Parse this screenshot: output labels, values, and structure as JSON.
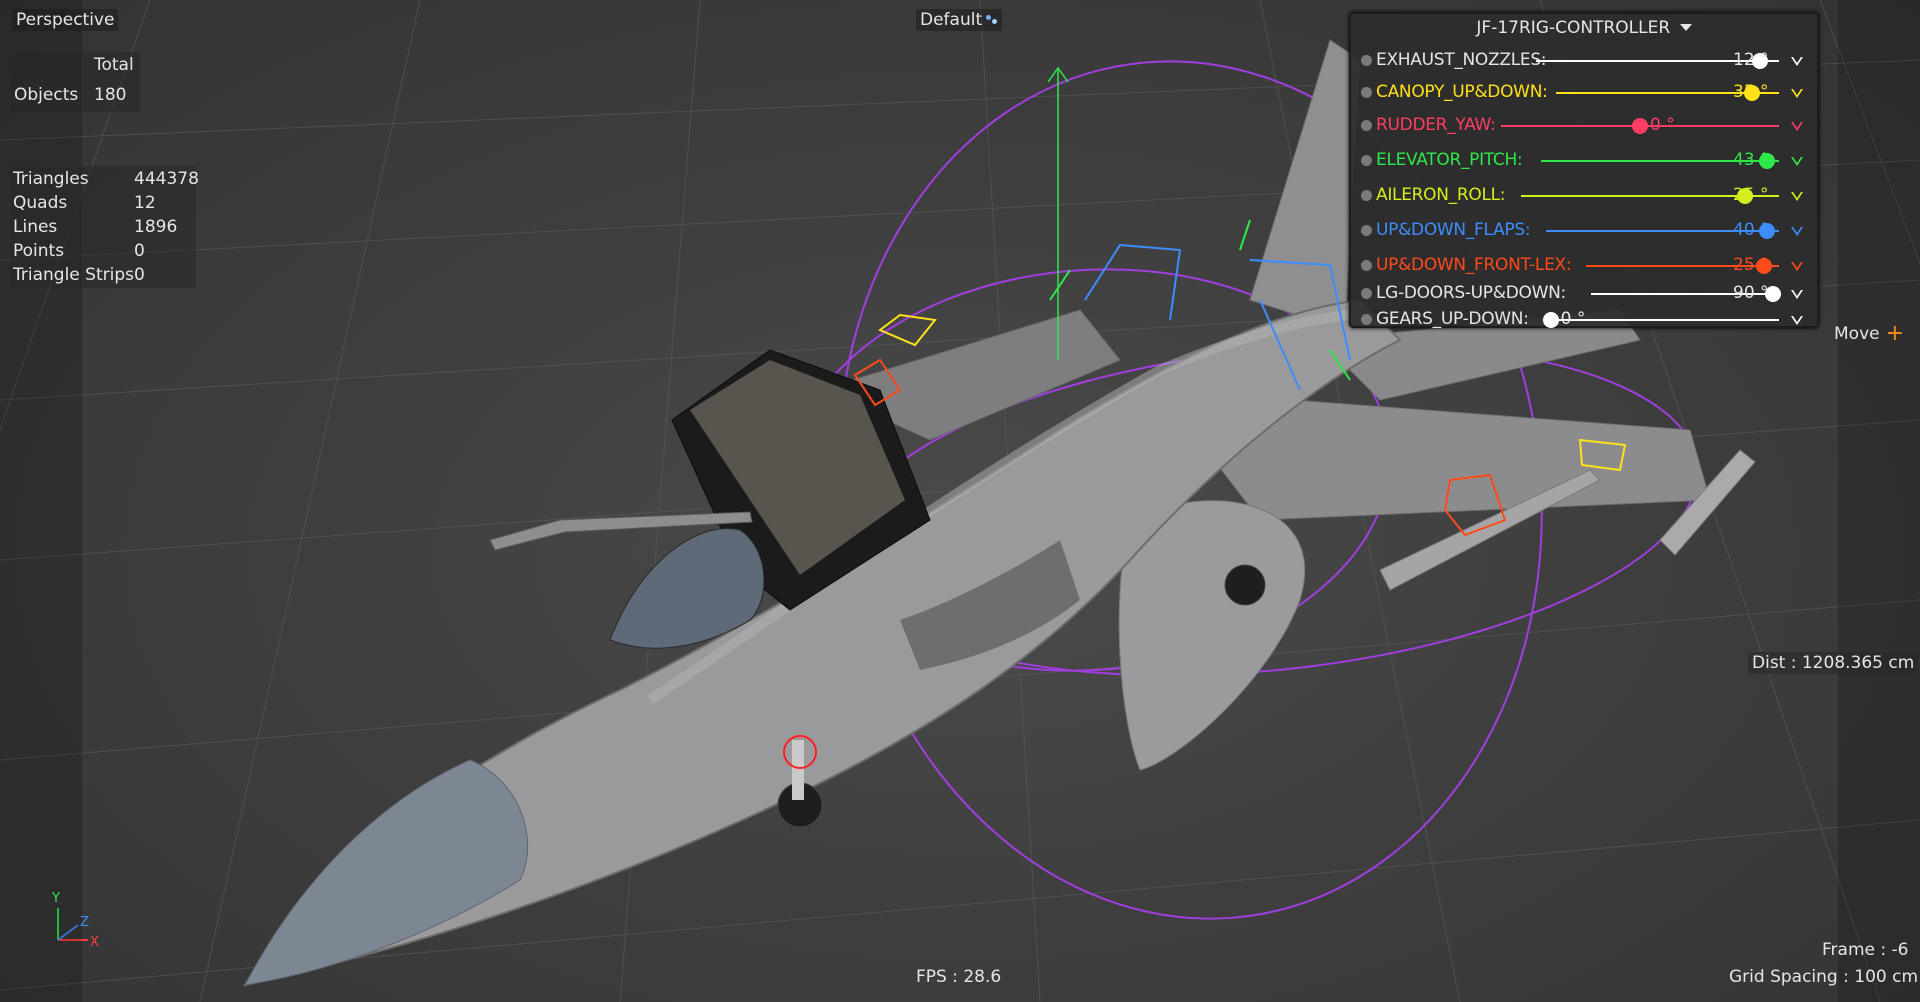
{
  "viewport": {
    "camera_label": "Perspective",
    "display_mode_label": "Default",
    "tool_label": "Move",
    "distance_readout": "Dist : 1208.365 cm",
    "fps_readout": "FPS : 28.6",
    "frame_readout": "Frame : -6",
    "grid_spacing_readout": "Grid Spacing : 100 cm",
    "axis_labels": {
      "y": "Y",
      "z": "Z",
      "x": "X"
    }
  },
  "stats": {
    "header": "Total",
    "objects_label": "Objects",
    "objects_value": "180",
    "rows": [
      {
        "label": "Triangles",
        "value": "444378"
      },
      {
        "label": "Quads",
        "value": "12"
      },
      {
        "label": "Lines",
        "value": "1896"
      },
      {
        "label": "Points",
        "value": "0"
      },
      {
        "label": "Triangle Strips",
        "value": "0"
      }
    ]
  },
  "controller": {
    "title": "JF-17RIG-CONTROLLER",
    "controls": [
      {
        "label": "EXHAUST_NOZZLES:",
        "value": "12 °",
        "level": 0.92,
        "color": "#ffffff",
        "label_color": "#e6e6e6"
      },
      {
        "label": "CANOPY_UP&DOWN:",
        "value": "35 °",
        "level": 0.88,
        "color": "#ffe11a",
        "label_color": "#ffe11a"
      },
      {
        "label": "RUDDER_YAW:",
        "value": "0 °",
        "level": 0.5,
        "color": "#ff3d63",
        "label_color": "#ff3d63"
      },
      {
        "label": "ELEVATOR_PITCH:",
        "value": "43 °",
        "level": 0.95,
        "color": "#2ee84a",
        "label_color": "#2ee84a"
      },
      {
        "label": "AILERON_ROLL:",
        "value": "25 °",
        "level": 0.87,
        "color": "#d7ee1e",
        "label_color": "#d7ee1e"
      },
      {
        "label": "UP&DOWN_FLAPS:",
        "value": "40 °",
        "level": 0.95,
        "color": "#3d8dff",
        "label_color": "#3d8dff"
      },
      {
        "label": "UP&DOWN_FRONT-LEX:",
        "value": "25 °",
        "level": 0.92,
        "color": "#ff4a1a",
        "label_color": "#ff4a1a"
      },
      {
        "label": "LG-DOORS-UP&DOWN:",
        "value": "90 °",
        "level": 0.97,
        "color": "#ffffff",
        "label_color": "#e6e6e6"
      },
      {
        "label": "GEARS_UP-DOWN:",
        "value": "0 °",
        "level": 0.02,
        "color": "#ffffff",
        "label_color": "#e6e6e6"
      }
    ]
  }
}
